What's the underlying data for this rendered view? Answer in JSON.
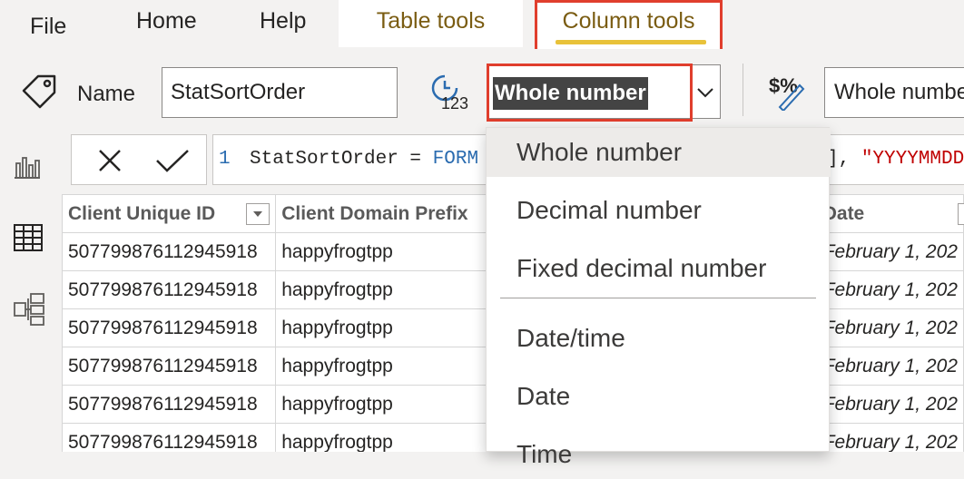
{
  "tabs": {
    "file": "File",
    "home": "Home",
    "help": "Help",
    "table_tools": "Table tools",
    "column_tools": "Column tools"
  },
  "ribbon": {
    "name_label": "Name",
    "name_value": "StatSortOrder",
    "data_type_value": "Whole number",
    "format_value": "Whole number"
  },
  "formula": {
    "line_number": "1",
    "text_prefix": "StatSortOrder = ",
    "text_fn": "FORM",
    "text_suffix_start": "], ",
    "text_suffix_str": "\"YYYYMMDD"
  },
  "table": {
    "headers": [
      "Client Unique ID",
      "Client Domain Prefix",
      "Date"
    ],
    "rows": [
      {
        "id": "507799876112945918",
        "prefix": "happyfrogtpp",
        "date": "February 1, 202"
      },
      {
        "id": "507799876112945918",
        "prefix": "happyfrogtpp",
        "date": "February 1, 202"
      },
      {
        "id": "507799876112945918",
        "prefix": "happyfrogtpp",
        "date": "February 1, 202"
      },
      {
        "id": "507799876112945918",
        "prefix": "happyfrogtpp",
        "date": "February 1, 202"
      },
      {
        "id": "507799876112945918",
        "prefix": "happyfrogtpp",
        "date": "February 1, 202"
      },
      {
        "id": "507799876112945918",
        "prefix": "happyfrogtpp",
        "date": "February 1, 202"
      }
    ]
  },
  "dropdown": {
    "options": [
      "Whole number",
      "Decimal number",
      "Fixed decimal number",
      "Date/time",
      "Date",
      "Time"
    ],
    "selected": "Whole number"
  },
  "colors": {
    "highlight_border": "#e03e2d",
    "tab_underline": "#e8c23a",
    "selected_value_bg": "#444444",
    "formula_keyword": "#2b6cb0",
    "formula_string": "#c00000"
  },
  "icons": {
    "name": "tag-icon",
    "data_type": "clock-123-icon",
    "format": "currency-percent-icon",
    "report_view": "bar-chart-icon",
    "data_view": "table-grid-icon",
    "model_view": "model-icon",
    "cancel": "close-icon",
    "commit": "check-icon",
    "caret": "chevron-down-icon",
    "filter": "filter-dropdown-icon"
  }
}
